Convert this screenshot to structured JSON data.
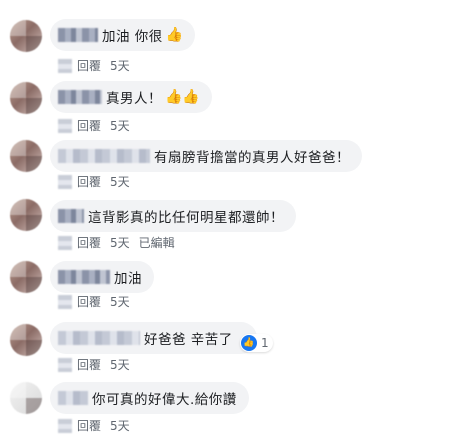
{
  "comments": [
    {
      "text": "加油 你很",
      "emoji": "👍",
      "reply": "回覆",
      "time": "5天"
    },
    {
      "text": "真男人！",
      "emoji": "👍👍",
      "reply": "回覆",
      "time": "5天"
    },
    {
      "text": "有扇膀背擔當的真男人好爸爸！",
      "reply": "回覆",
      "time": "5天"
    },
    {
      "text": "這背影真的比任何明星都還帥！",
      "reply": "回覆",
      "time": "5天",
      "edited": "已編輯"
    },
    {
      "text": "加油",
      "reply": "回覆",
      "time": "5天"
    },
    {
      "text": "好爸爸 辛苦了",
      "reply": "回覆",
      "time": "5天",
      "reactions": {
        "icon": "like-icon",
        "count": "1"
      }
    },
    {
      "text": "你可真的好偉大.給你讚",
      "reply": "回覆",
      "time": "5天"
    }
  ],
  "colors": {
    "bubble": "#f2f3f5",
    "meta": "#606770",
    "like": "#1877f2"
  }
}
